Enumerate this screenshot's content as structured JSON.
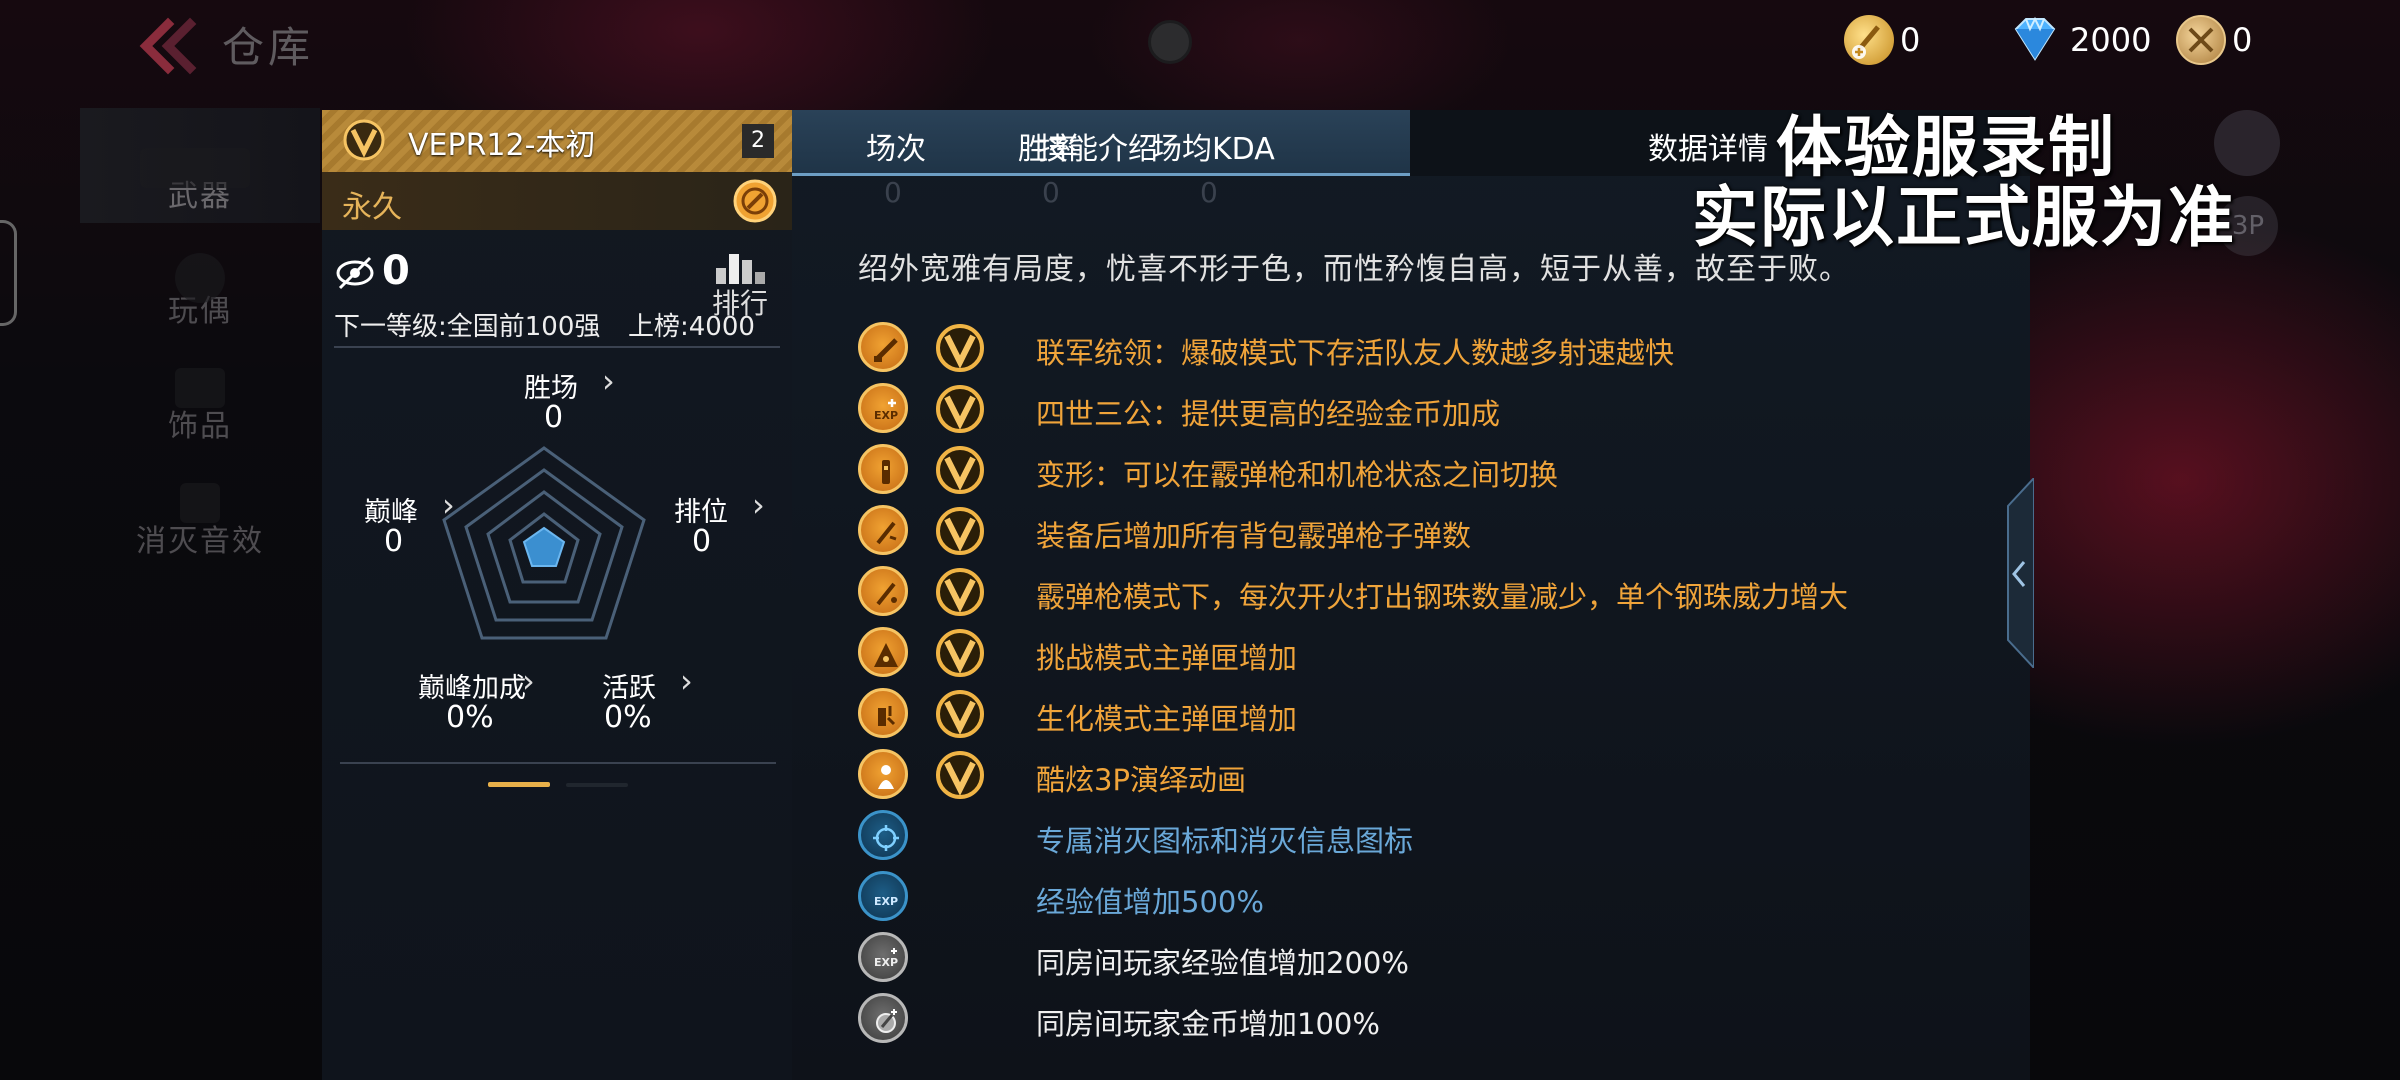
{
  "header": {
    "title": "仓库",
    "currencies": [
      {
        "name": "gold-coin",
        "value": "0"
      },
      {
        "name": "diamond",
        "value": "2000"
      },
      {
        "name": "medal",
        "value": "0"
      }
    ]
  },
  "sidebar": {
    "items": [
      {
        "label": "武器",
        "active": true
      },
      {
        "label": "玩偶",
        "active": false
      },
      {
        "label": "饰品",
        "active": false
      },
      {
        "label": "消灭音效",
        "active": false
      }
    ]
  },
  "weapon": {
    "name": "VEPR12-本初",
    "level": "2",
    "duration": "永久",
    "rank_count": "0",
    "rank_label": "排行",
    "next_level": "下一等级:全国前100强",
    "rank_requirement": "上榜:4000",
    "stats": {
      "wins": {
        "label": "胜场",
        "value": "0"
      },
      "peak": {
        "label": "巅峰",
        "value": "0"
      },
      "ranked": {
        "label": "排位",
        "value": "0"
      },
      "peak_bonus": {
        "label": "巅峰加成",
        "value": "0%"
      },
      "active": {
        "label": "活跃",
        "value": "0%"
      }
    },
    "page_indicator": {
      "current": 1,
      "total": 2
    }
  },
  "panel": {
    "tabs": [
      {
        "label": "技能介绍",
        "active": true
      },
      {
        "label": "数据详情",
        "active": false
      }
    ],
    "behind_text": [
      "场次",
      "胜率",
      "场均KDA",
      "0",
      "0",
      "0"
    ],
    "bio": "绍外宽雅有局度，忧喜不形于色，而性矜愎自高，短于从善，故至于败。",
    "skills": [
      {
        "icon": "shotgun-icon",
        "tier": "gold",
        "has_v": true,
        "text": "联军统领：爆破模式下存活队友人数越多射速越快"
      },
      {
        "icon": "exp-plus-icon",
        "tier": "gold",
        "has_v": true,
        "text": "四世三公：提供更高的经验金币加成"
      },
      {
        "icon": "transform-icon",
        "tier": "gold",
        "has_v": true,
        "text": "变形：可以在霰弹枪和机枪状态之间切换"
      },
      {
        "icon": "ammo-icon",
        "tier": "gold",
        "has_v": true,
        "text": "装备后增加所有背包霰弹枪子弹数"
      },
      {
        "icon": "pellet-icon",
        "tier": "gold",
        "has_v": true,
        "text": "霰弹枪模式下，每次开火打出钢珠数量减少，单个钢珠威力增大"
      },
      {
        "icon": "challenge-icon",
        "tier": "gold",
        "has_v": true,
        "text": "挑战模式主弹匣增加"
      },
      {
        "icon": "zombie-icon",
        "tier": "gold",
        "has_v": true,
        "text": "生化模式主弹匣增加"
      },
      {
        "icon": "character-icon",
        "tier": "gold",
        "has_v": true,
        "text": "酷炫3P演绎动画"
      },
      {
        "icon": "kill-icon",
        "tier": "blue",
        "has_v": false,
        "text": "专属消灭图标和消灭信息图标"
      },
      {
        "icon": "exp-icon",
        "tier": "blue",
        "has_v": false,
        "text": "经验值增加500%"
      },
      {
        "icon": "room-exp-icon",
        "tier": "gray",
        "has_v": false,
        "text": "同房间玩家经验值增加200%"
      },
      {
        "icon": "room-coin-icon",
        "tier": "gray",
        "has_v": false,
        "text": "同房间玩家金币增加100%"
      }
    ]
  },
  "watermark": {
    "line1": "体验服录制",
    "line2": "实际以正式服为准"
  },
  "corner": {
    "view_label": "3P"
  },
  "colors": {
    "gold": "#f0a43a",
    "blue": "#6aa8d8",
    "tab_active": "#2a4258",
    "header_gold": "#b88a3a"
  }
}
